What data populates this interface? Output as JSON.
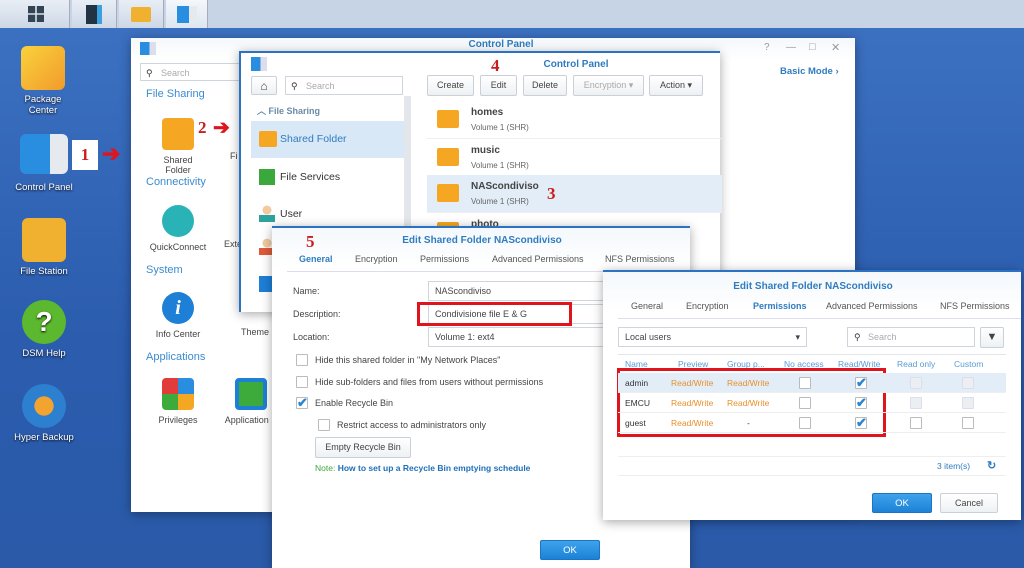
{
  "desktop": {
    "icons": [
      {
        "label_l1": "Package",
        "label_l2": "Center"
      },
      {
        "label": "Control Panel"
      },
      {
        "label": "File Station"
      },
      {
        "label": "DSM Help"
      },
      {
        "label": "Hyper Backup"
      }
    ]
  },
  "annotations": {
    "step1": "1",
    "step2": "2",
    "step3": "3",
    "step4": "4",
    "step5": "5"
  },
  "back_window": {
    "title": "Control Panel",
    "search_placeholder": "Search",
    "basic_mode": "Basic Mode",
    "window_controls": [
      "?",
      "—",
      "□",
      "✕"
    ],
    "categories": [
      {
        "name": "File Sharing",
        "items": [
          {
            "l1": "Shared",
            "l2": "Folder"
          },
          {
            "l1": "Fi"
          }
        ]
      },
      {
        "name": "Connectivity",
        "items": [
          {
            "l1": "QuickConnect"
          },
          {
            "l1": "Exte"
          }
        ]
      },
      {
        "name": "System",
        "items": [
          {
            "l1": "Info Center"
          },
          {
            "l1": "Theme"
          }
        ]
      },
      {
        "name": "Applications",
        "items": [
          {
            "l1": "Privileges"
          },
          {
            "l1": "Application P"
          }
        ]
      }
    ]
  },
  "cp_window": {
    "title": "Control Panel",
    "search_placeholder": "Search",
    "section": "File Sharing",
    "nav": [
      {
        "label": "Shared Folder"
      },
      {
        "label": "File Services"
      },
      {
        "label": "User"
      }
    ],
    "toolbar": {
      "create": "Create",
      "edit": "Edit",
      "delete": "Delete",
      "encryption": "Encryption",
      "action": "Action"
    },
    "folders": [
      {
        "name": "homes",
        "sub": "Volume 1 (SHR)"
      },
      {
        "name": "music",
        "sub": "Volume 1 (SHR)"
      },
      {
        "name": "NAScondiviso",
        "sub": "Volume 1 (SHR)"
      },
      {
        "name": "photo",
        "sub": ""
      }
    ]
  },
  "general_dialog": {
    "title": "Edit Shared Folder NAScondiviso",
    "tabs": [
      "General",
      "Encryption",
      "Permissions",
      "Advanced Permissions",
      "NFS Permissions"
    ],
    "name_label": "Name:",
    "name_value": "NAScondiviso",
    "desc_label": "Description:",
    "desc_value": "Condivisione file E & G",
    "loc_label": "Location:",
    "loc_value": "Volume 1:  ext4",
    "opt_hide": "Hide this shared folder in \"My Network Places\"",
    "opt_hide_sub": "Hide sub-folders and files from users without permissions",
    "opt_recycle": "Enable Recycle Bin",
    "opt_restrict": "Restrict access to administrators only",
    "empty_btn": "Empty Recycle Bin",
    "note_prefix": "Note:",
    "note_link": "How to set up a Recycle Bin emptying schedule",
    "ok": "OK"
  },
  "perm_dialog": {
    "title": "Edit Shared Folder NAScondiviso",
    "tabs": [
      "General",
      "Encryption",
      "Permissions",
      "Advanced Permissions",
      "NFS Permissions"
    ],
    "user_type": "Local users",
    "search_placeholder": "Search",
    "columns": [
      "Name",
      "Preview",
      "Group p...",
      "No access",
      "Read/Write",
      "Read only",
      "Custom"
    ],
    "rows": [
      {
        "name": "admin",
        "preview": "Read/Write",
        "group": "Read/Write",
        "no_access": false,
        "read_write": true,
        "read_only": false,
        "custom": false,
        "locked": true
      },
      {
        "name": "EMCU",
        "preview": "Read/Write",
        "group": "Read/Write",
        "no_access": false,
        "read_write": true,
        "read_only": false,
        "custom": false,
        "locked": true
      },
      {
        "name": "guest",
        "preview": "Read/Write",
        "group": "-",
        "no_access": false,
        "read_write": true,
        "read_only": false,
        "custom": false,
        "locked": false
      }
    ],
    "count": "3 item(s)",
    "ok": "OK",
    "cancel": "Cancel"
  },
  "colors": {
    "accent": "#2f7cc0",
    "highlight": "#e0141c",
    "folder": "#f5a623",
    "permission_text": "#e8902a"
  }
}
